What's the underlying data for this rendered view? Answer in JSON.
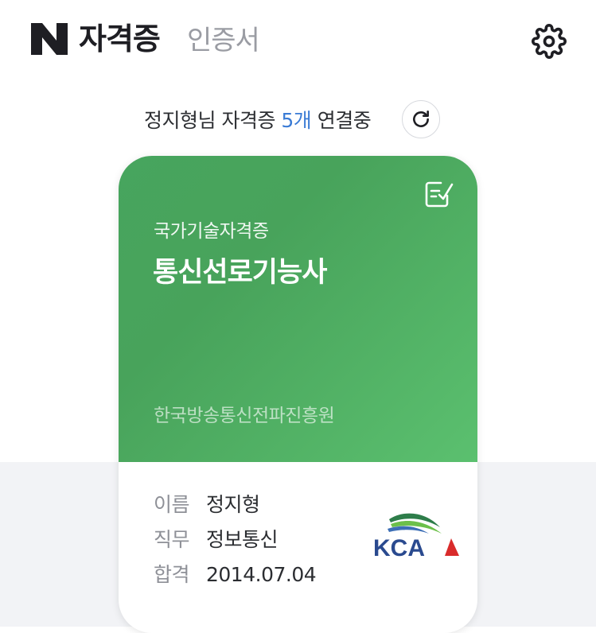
{
  "header": {
    "logo_icon": "n-logo-icon",
    "tab_active": "자격증",
    "tab_inactive": "인증서",
    "settings_icon": "gear-icon"
  },
  "summary": {
    "prefix": "정지형님 자격증 ",
    "count": "5개",
    "suffix": " 연결중",
    "refresh_icon": "refresh-icon",
    "count_color": "#3a7bd5"
  },
  "card": {
    "category": "국가기술자격증",
    "title": "통신선로기능사",
    "issuer": "한국방송통신전파진흥원",
    "check_icon": "certificate-check-icon",
    "accent_color": "#4caf63",
    "fields": [
      {
        "label": "이름",
        "value": "정지형"
      },
      {
        "label": "직무",
        "value": "정보통신"
      },
      {
        "label": "합격",
        "value": "2014.07.04"
      }
    ],
    "issuer_logo": {
      "icon": "kca-logo",
      "text": "KCA"
    }
  }
}
